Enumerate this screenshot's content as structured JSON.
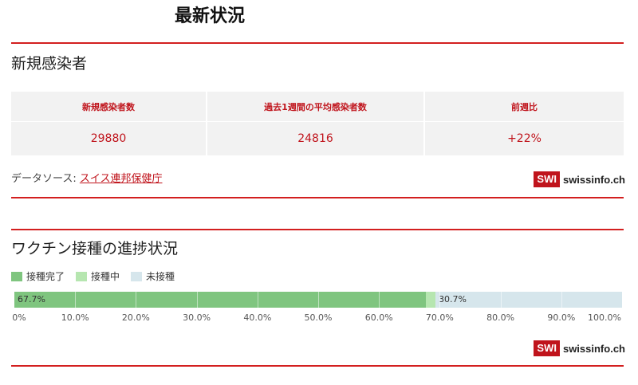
{
  "page_title": "最新状況",
  "new_infections": {
    "heading": "新規感染者",
    "columns": [
      "新規感染者数",
      "過去1週間の平均感染者数",
      "前週比"
    ],
    "values": [
      "29880",
      "24816",
      "+22%"
    ],
    "source_prefix": "データソース: ",
    "source_link": "スイス連邦保健庁"
  },
  "vaccination": {
    "heading": "ワクチン接種の進捗状況",
    "legend": [
      {
        "label": "接種完了",
        "color": "#7fc57f"
      },
      {
        "label": "接種中",
        "color": "#b6e6b0"
      },
      {
        "label": "未接種",
        "color": "#d6e6ec"
      }
    ],
    "progress": {
      "completed": 67.7,
      "in_progress": 1.6,
      "not_vaccinated": 30.7
    },
    "labels": {
      "completed": "67.7%",
      "not_vaccinated": "30.7%"
    },
    "ticks": [
      "0%",
      "10.0%",
      "20.0%",
      "30.0%",
      "40.0%",
      "50.0%",
      "60.0%",
      "70.0%",
      "80.0%",
      "90.0%",
      "100.0%"
    ]
  },
  "logo": {
    "mark": "SWI",
    "text": "swissinfo.ch"
  },
  "colors": {
    "accent": "#c0141c",
    "rule": "#d31f1f"
  }
}
